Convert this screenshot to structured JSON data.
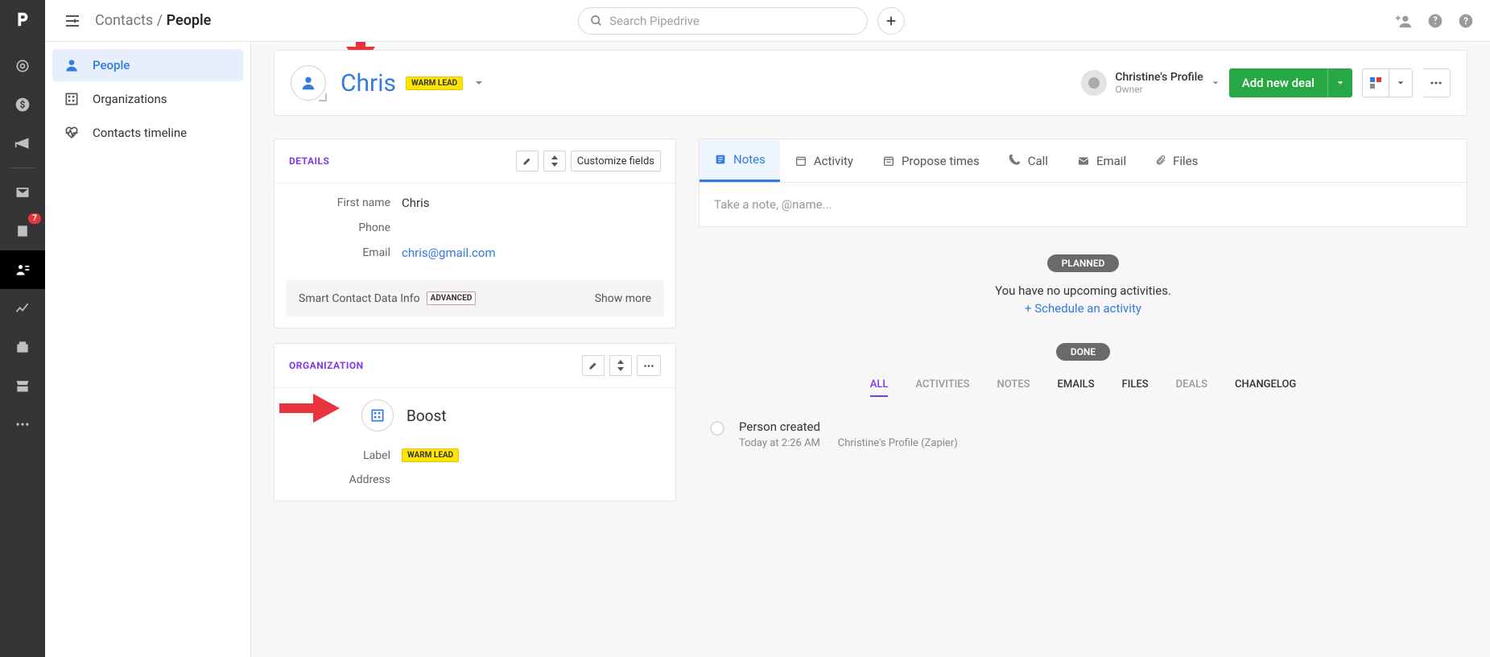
{
  "breadcrumb": {
    "parent": "Contacts",
    "current": "People"
  },
  "search": {
    "placeholder": "Search Pipedrive"
  },
  "nav_badge": "7",
  "subnav": {
    "people": "People",
    "organizations": "Organizations",
    "timeline": "Contacts timeline"
  },
  "person": {
    "name": "Chris",
    "label": "WARM LEAD"
  },
  "owner": {
    "name": "Christine's Profile",
    "role": "Owner"
  },
  "add_deal_button": "Add new deal",
  "details": {
    "title": "DETAILS",
    "customize": "Customize fields",
    "fields": {
      "first_name_label": "First name",
      "first_name_value": "Chris",
      "phone_label": "Phone",
      "email_label": "Email",
      "email_value": "chris@gmail.com"
    },
    "smart_data": "Smart Contact Data Info",
    "advanced": "ADVANCED",
    "show_more": "Show more"
  },
  "organization": {
    "title": "ORGANIZATION",
    "name": "Boost",
    "label_field": "Label",
    "label_value": "WARM LEAD",
    "address_field": "Address"
  },
  "tabs": {
    "notes": "Notes",
    "activity": "Activity",
    "propose": "Propose times",
    "call": "Call",
    "email": "Email",
    "files": "Files"
  },
  "note_placeholder": "Take a note, @name...",
  "feed": {
    "planned": "PLANNED",
    "done": "DONE",
    "no_upcoming": "You have no upcoming activities.",
    "schedule": "+ Schedule an activity",
    "filters": {
      "all": "ALL",
      "activities": "ACTIVITIES",
      "notes": "NOTES",
      "emails": "EMAILS",
      "files": "FILES",
      "deals": "DEALS",
      "changelog": "CHANGELOG"
    },
    "item": {
      "title": "Person created",
      "time": "Today at 2:26 AM",
      "by": "Christine's Profile (Zapier)"
    }
  }
}
